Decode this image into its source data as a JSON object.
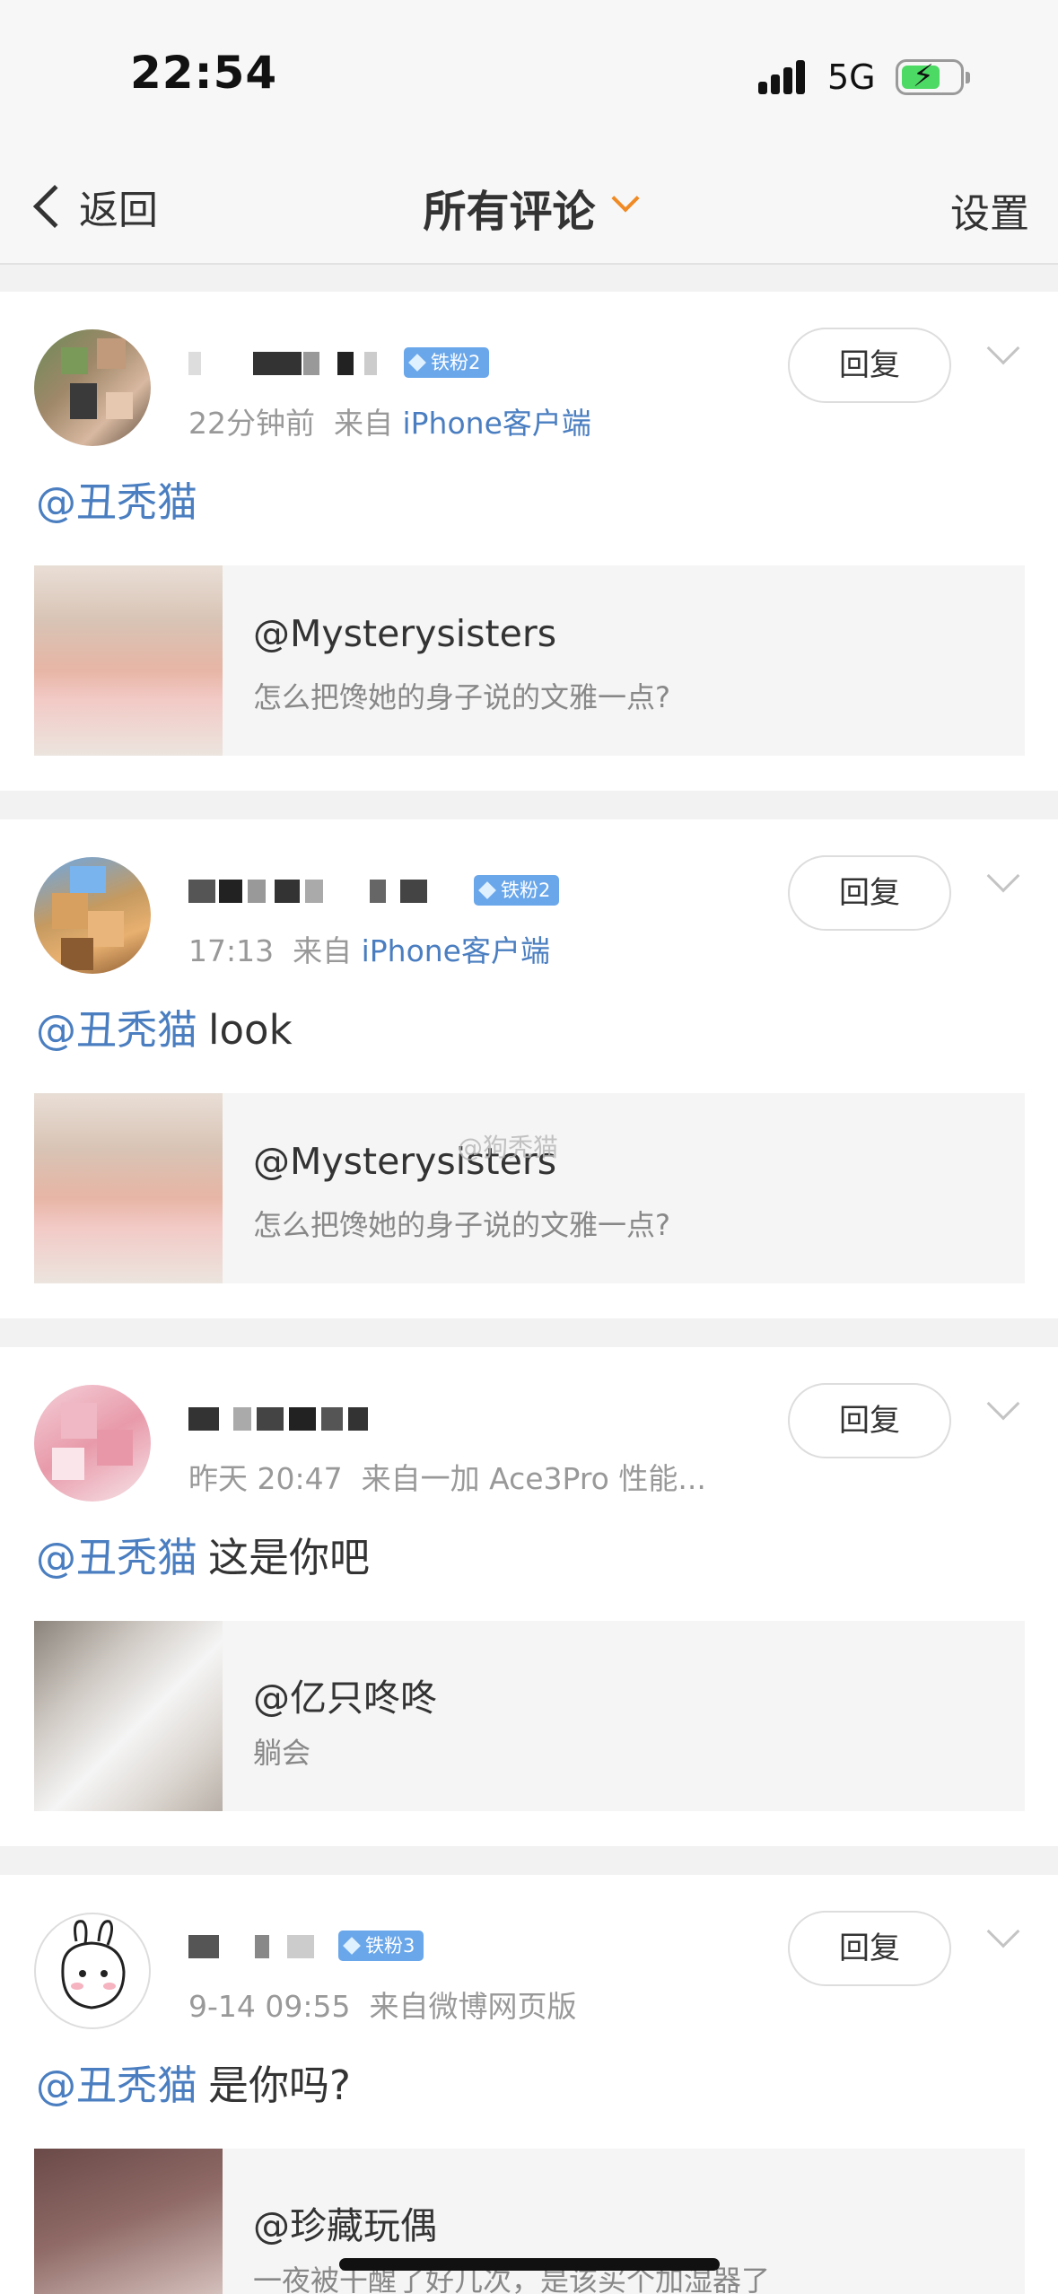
{
  "status_bar": {
    "time": "22:54",
    "network": "5G",
    "battery_state": "charging"
  },
  "nav": {
    "back_label": "返回",
    "title": "所有评论",
    "settings_label": "设置"
  },
  "comments": [
    {
      "badge": "铁粉2",
      "time": "22分钟前",
      "source_prefix": "来自",
      "source": "iPhone客户端",
      "reply_label": "回复",
      "mention": "@丑秃猫",
      "text": "",
      "quote": {
        "user": "@Mysterysisters",
        "text": "怎么把馋她的身子说的文雅一点?"
      }
    },
    {
      "badge": "铁粉2",
      "time": "17:13",
      "source_prefix": "来自",
      "source": "iPhone客户端",
      "reply_label": "回复",
      "mention": "@丑秃猫",
      "text": "look",
      "quote": {
        "user": "@Mysterysisters",
        "text": "怎么把馋她的身子说的文雅一点?"
      }
    },
    {
      "badge": "",
      "time": "昨天 20:47",
      "source_prefix": "来自",
      "source": "一加 Ace3Pro 性能...",
      "reply_label": "回复",
      "mention": "@丑秃猫",
      "text": "这是你吧",
      "quote": {
        "user": "@亿只咚咚",
        "text": "躺会"
      }
    },
    {
      "badge": "铁粉3",
      "time": "9-14 09:55",
      "source_prefix": "来自",
      "source": "微博网页版",
      "reply_label": "回复",
      "mention": "@丑秃猫",
      "text": "是你吗?",
      "quote": {
        "user": "@珍藏玩偶",
        "text": "一夜被干醒了好几次，是该买个加湿器了"
      }
    }
  ],
  "watermark": "@狗秃猫",
  "colors": {
    "link": "#4a7ec0",
    "accent": "#f08a24",
    "badge": "#6aa7ea",
    "background": "#f2f2f2"
  }
}
